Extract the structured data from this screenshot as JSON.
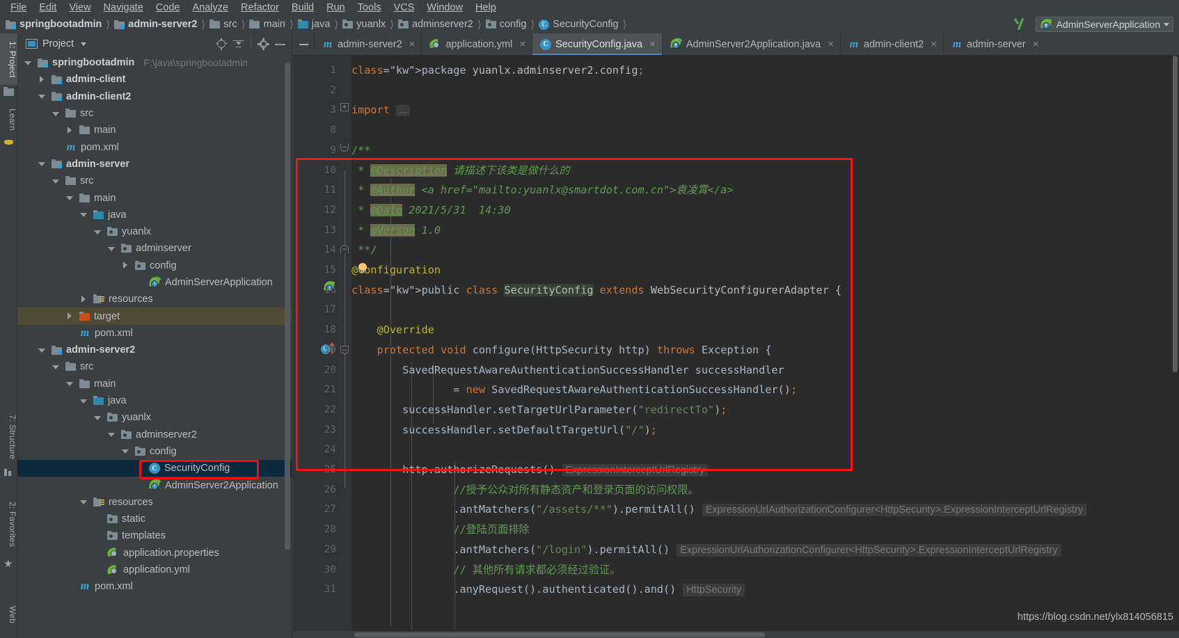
{
  "menubar": {
    "items": [
      "File",
      "Edit",
      "View",
      "Navigate",
      "Code",
      "Analyze",
      "Refactor",
      "Build",
      "Run",
      "Tools",
      "VCS",
      "Window",
      "Help"
    ]
  },
  "breadcrumb": {
    "items": [
      {
        "label": "springbootadmin",
        "icon": "module-icon",
        "bold": true
      },
      {
        "label": "admin-server2",
        "icon": "module-icon",
        "bold": true
      },
      {
        "label": "src",
        "icon": "folder-icon",
        "bold": false
      },
      {
        "label": "main",
        "icon": "folder-icon",
        "bold": false
      },
      {
        "label": "java",
        "icon": "folder-source-icon",
        "bold": false
      },
      {
        "label": "yuanlx",
        "icon": "package-icon",
        "bold": false
      },
      {
        "label": "adminserver2",
        "icon": "package-icon",
        "bold": false
      },
      {
        "label": "config",
        "icon": "package-icon",
        "bold": false
      },
      {
        "label": "SecurityConfig",
        "icon": "class-icon",
        "bold": false
      }
    ],
    "separator": "〉"
  },
  "run_config": {
    "label": "AdminServerApplication",
    "icon": "spring-boot-icon"
  },
  "toolstrip": {
    "left": [
      {
        "label": "1: Project",
        "active": true,
        "icon": "project-icon"
      },
      {
        "label": "Learn",
        "active": false,
        "icon": "learn-icon"
      },
      {
        "label": "7: Structure",
        "active": false,
        "icon": "structure-icon"
      },
      {
        "label": "2: Favorites",
        "active": false,
        "icon": "star-icon"
      },
      {
        "label": "Web",
        "active": false,
        "icon": "web-icon"
      }
    ]
  },
  "project_panel": {
    "title": "Project",
    "header_icons": [
      "locate-icon",
      "collapse-all-icon",
      "settings-gear-icon",
      "hide-icon"
    ],
    "tree": [
      {
        "indent": 0,
        "twisty": "down",
        "icon": "module-icon",
        "label": "springbootadmin",
        "bold": true,
        "path": "F:\\java\\springbootadmin"
      },
      {
        "indent": 1,
        "twisty": "right",
        "icon": "module-icon",
        "label": "admin-client",
        "bold": true
      },
      {
        "indent": 1,
        "twisty": "down",
        "icon": "module-icon",
        "label": "admin-client2",
        "bold": true
      },
      {
        "indent": 2,
        "twisty": "down",
        "icon": "folder-icon",
        "label": "src"
      },
      {
        "indent": 3,
        "twisty": "right",
        "icon": "folder-icon",
        "label": "main"
      },
      {
        "indent": 2,
        "twisty": "none",
        "icon": "maven-icon",
        "label": "pom.xml"
      },
      {
        "indent": 1,
        "twisty": "down",
        "icon": "module-icon",
        "label": "admin-server",
        "bold": true
      },
      {
        "indent": 2,
        "twisty": "down",
        "icon": "folder-icon",
        "label": "src"
      },
      {
        "indent": 3,
        "twisty": "down",
        "icon": "folder-icon",
        "label": "main"
      },
      {
        "indent": 4,
        "twisty": "down",
        "icon": "folder-source-icon",
        "label": "java"
      },
      {
        "indent": 5,
        "twisty": "down",
        "icon": "package-icon",
        "label": "yuanlx"
      },
      {
        "indent": 6,
        "twisty": "down",
        "icon": "package-icon",
        "label": "adminserver"
      },
      {
        "indent": 7,
        "twisty": "right",
        "icon": "package-icon",
        "label": "config"
      },
      {
        "indent": 8,
        "twisty": "none",
        "icon": "spring-run-icon",
        "label": "AdminServerApplication"
      },
      {
        "indent": 4,
        "twisty": "right",
        "icon": "resources-icon",
        "label": "resources"
      },
      {
        "indent": 3,
        "twisty": "right",
        "icon": "folder-target-icon",
        "label": "target",
        "row_style": "target"
      },
      {
        "indent": 3,
        "twisty": "none",
        "icon": "maven-icon",
        "label": "pom.xml"
      },
      {
        "indent": 1,
        "twisty": "down",
        "icon": "module-icon",
        "label": "admin-server2",
        "bold": true
      },
      {
        "indent": 2,
        "twisty": "down",
        "icon": "folder-icon",
        "label": "src"
      },
      {
        "indent": 3,
        "twisty": "down",
        "icon": "folder-icon",
        "label": "main"
      },
      {
        "indent": 4,
        "twisty": "down",
        "icon": "folder-source-icon",
        "label": "java"
      },
      {
        "indent": 5,
        "twisty": "down",
        "icon": "package-icon",
        "label": "yuanlx"
      },
      {
        "indent": 6,
        "twisty": "down",
        "icon": "package-icon",
        "label": "adminserver2"
      },
      {
        "indent": 7,
        "twisty": "down",
        "icon": "package-icon",
        "label": "config"
      },
      {
        "indent": 8,
        "twisty": "none",
        "icon": "class-icon",
        "label": "SecurityConfig",
        "row_style": "selected",
        "highlighted": true
      },
      {
        "indent": 8,
        "twisty": "none",
        "icon": "spring-run-icon",
        "label": "AdminServer2Application"
      },
      {
        "indent": 4,
        "twisty": "down",
        "icon": "resources-icon",
        "label": "resources"
      },
      {
        "indent": 5,
        "twisty": "none",
        "icon": "package-icon",
        "label": "static"
      },
      {
        "indent": 5,
        "twisty": "none",
        "icon": "package-icon",
        "label": "templates"
      },
      {
        "indent": 5,
        "twisty": "none",
        "icon": "yml-icon",
        "label": "application.properties"
      },
      {
        "indent": 5,
        "twisty": "none",
        "icon": "yml-icon",
        "label": "application.yml"
      },
      {
        "indent": 3,
        "twisty": "none",
        "icon": "maven-icon",
        "label": "pom.xml"
      }
    ]
  },
  "editor_tabs": [
    {
      "label": "admin-server2",
      "icon": "maven-icon",
      "active": false,
      "close": "×"
    },
    {
      "label": "application.yml",
      "icon": "yml-icon",
      "active": false,
      "close": "×"
    },
    {
      "label": "SecurityConfig.java",
      "icon": "class-icon",
      "active": true,
      "close": "×"
    },
    {
      "label": "AdminServer2Application.java",
      "icon": "spring-run-icon",
      "active": false,
      "close": "×"
    },
    {
      "label": "admin-client2",
      "icon": "maven-icon",
      "active": false,
      "close": "×"
    },
    {
      "label": "admin-server",
      "icon": "maven-icon",
      "active": false,
      "close": "×"
    }
  ],
  "code": {
    "filename": "SecurityConfig.java",
    "lines": [
      {
        "num": "1",
        "text": "package yuanlx.adminserver2.config;"
      },
      {
        "num": "2",
        "text": ""
      },
      {
        "num": "3",
        "text": "import ..."
      },
      {
        "num": "8",
        "text": ""
      },
      {
        "num": "9",
        "text": "/**"
      },
      {
        "num": "10",
        "text": " * @Description 请描述下该类是做什么的"
      },
      {
        "num": "11",
        "text": " * @Author <a href=\"mailto:yuanlx@smartdot.com.cn\">袁凌霄</a>"
      },
      {
        "num": "12",
        "text": " * @Date 2021/5/31  14:30"
      },
      {
        "num": "13",
        "text": " * @Verson 1.0"
      },
      {
        "num": "14",
        "text": " **/"
      },
      {
        "num": "15",
        "text": "@Configuration"
      },
      {
        "num": "16",
        "text": "public class SecurityConfig extends WebSecurityConfigurerAdapter {"
      },
      {
        "num": "17",
        "text": ""
      },
      {
        "num": "18",
        "text": "    @Override"
      },
      {
        "num": "19",
        "text": "    protected void configure(HttpSecurity http) throws Exception {"
      },
      {
        "num": "20",
        "text": "        SavedRequestAwareAuthenticationSuccessHandler successHandler"
      },
      {
        "num": "21",
        "text": "                = new SavedRequestAwareAuthenticationSuccessHandler();"
      },
      {
        "num": "22",
        "text": "        successHandler.setTargetUrlParameter(\"redirectTo\");"
      },
      {
        "num": "23",
        "text": "        successHandler.setDefaultTargetUrl(\"/\");"
      },
      {
        "num": "24",
        "text": ""
      },
      {
        "num": "25",
        "text": "        http.authorizeRequests()"
      },
      {
        "num": "26",
        "text": "                //授予公众对所有静态资产和登录页面的访问权限。"
      },
      {
        "num": "27",
        "text": "                .antMatchers(\"/assets/**\").permitAll()"
      },
      {
        "num": "28",
        "text": "                //登陆页面排除"
      },
      {
        "num": "29",
        "text": "                .antMatchers(\"/login\").permitAll()"
      },
      {
        "num": "30",
        "text": "                // 其他所有请求都必须经过验证。"
      },
      {
        "num": "31",
        "text": "                .anyRequest().authenticated().and()"
      }
    ],
    "inlay_hints": {
      "line25": "ExpressionInterceptUrlRegistry",
      "line27": "ExpressionUrlAuthorizationConfigurer<HttpSecurity>.ExpressionInterceptUrlRegistry",
      "line29": "ExpressionUrlAuthorizationConfigurer<HttpSecurity>.ExpressionInterceptUrlRegistry",
      "line31": "HttpSecurity"
    },
    "javadoc": {
      "description_tag": "@Description",
      "description_value": "请描述下该类是做什么的",
      "author_tag": "@Author",
      "author_value": "<a href=\"mailto:yuanlx@smartdot.com.cn\">袁凌霄</a>",
      "date_tag": "@Date",
      "date_value": "2021/5/31  14:30",
      "verson_tag": "@Verson",
      "verson_value": "1.0"
    }
  },
  "watermark": {
    "text": "https://blog.csdn.net/ylx814056815"
  },
  "colors": {
    "accent": "#3592c4",
    "highlight_box": "#f41414",
    "selection": "#0d293e",
    "keyword": "#cc7832",
    "string": "#6a8759",
    "comment": "#629755",
    "annotation": "#bbb529",
    "identifier": "#a9b7c6",
    "editor_bg": "#2b2b2b",
    "panel_bg": "#3c3f41"
  }
}
